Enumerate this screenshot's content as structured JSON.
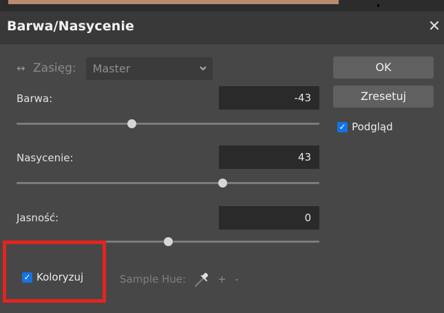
{
  "dialog": {
    "title": "Barwa/Nasycenie",
    "close_glyph": "✕"
  },
  "range": {
    "icon": "↔",
    "label": "Zasięg:",
    "selected": "Master"
  },
  "sliders": [
    {
      "label": "Barwa:",
      "value": "-43",
      "position_fraction": 0.38
    },
    {
      "label": "Nasycenie:",
      "value": "43",
      "position_fraction": 0.68
    },
    {
      "label": "Jasność:",
      "value": "0",
      "position_fraction": 0.5
    }
  ],
  "buttons": {
    "ok": "OK",
    "reset": "Zresetuj"
  },
  "preview": {
    "label": "Podgląd",
    "checked": true
  },
  "colorize": {
    "label": "Koloryzuj",
    "checked": true
  },
  "sample_hue": {
    "label": "Sample Hue:",
    "plus": "+",
    "minus": "-"
  },
  "colors": {
    "accent": "#1473e6",
    "highlight": "#e6241f"
  }
}
